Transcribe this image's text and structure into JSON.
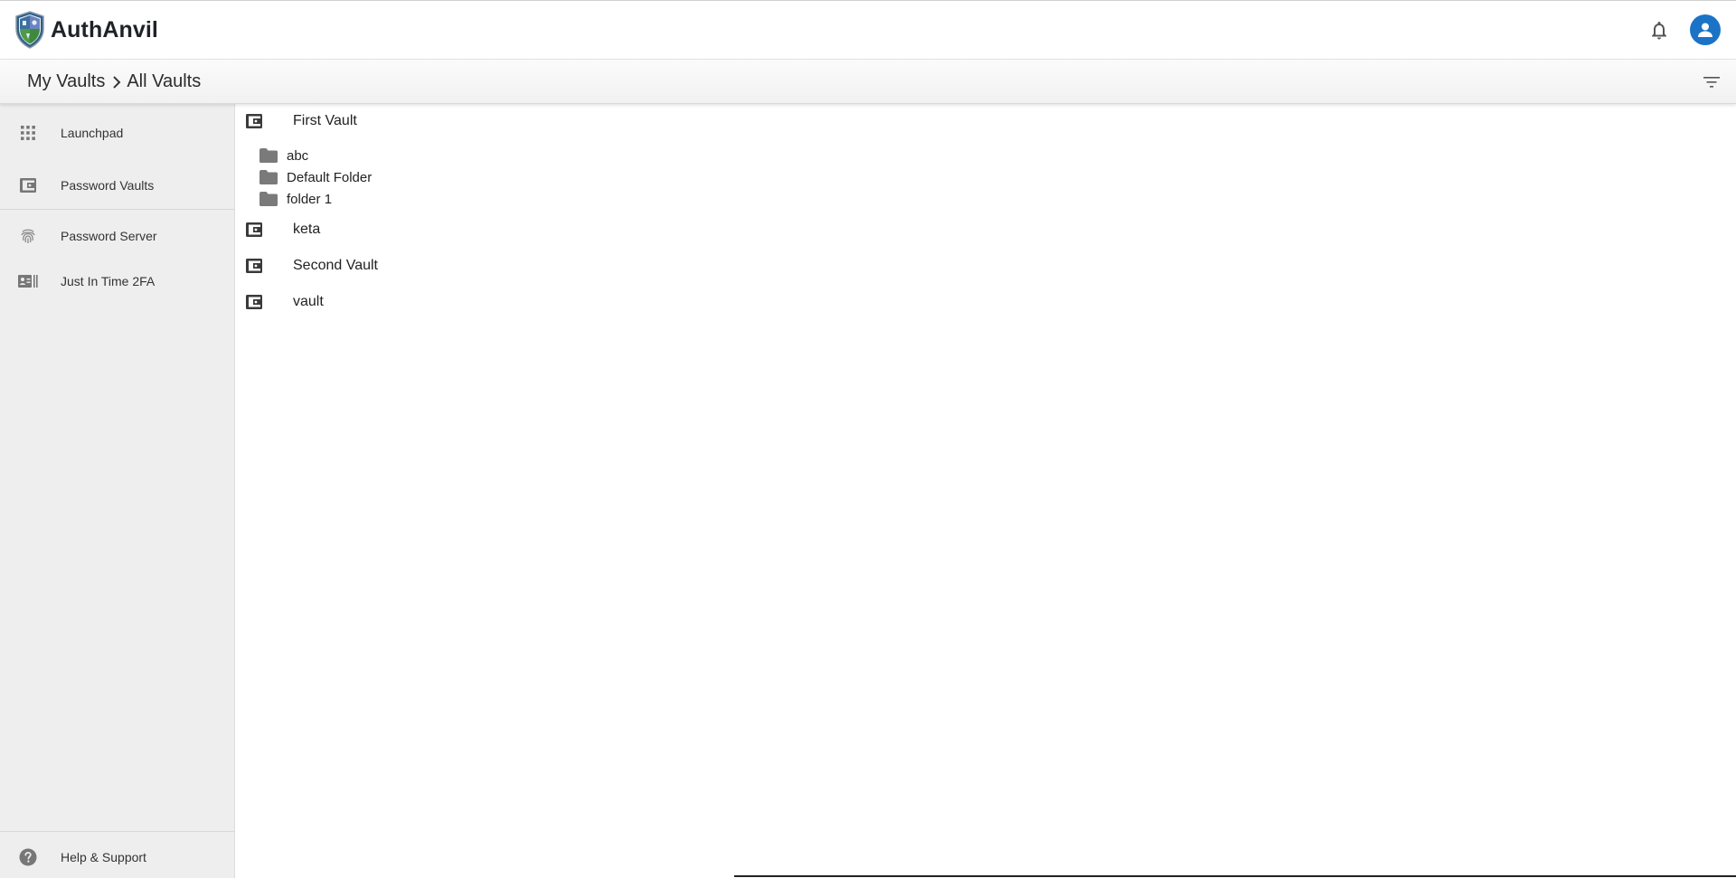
{
  "header": {
    "brand_name": "AuthAnvil",
    "logo_icon": "authanvil-shield-logo",
    "notification_icon": "bell-icon",
    "account_icon": "account-avatar-icon",
    "accent_color": "#1a73c7"
  },
  "breadcrumb": {
    "items": [
      "My Vaults",
      "All Vaults"
    ],
    "separator_icon": "chevron-right-icon",
    "filter_icon": "filter-icon"
  },
  "sidebar": {
    "items": [
      {
        "label": "Launchpad",
        "icon": "apps-grid-icon"
      },
      {
        "label": "Password Vaults",
        "icon": "vault-wallet-icon"
      },
      {
        "label": "Password Server",
        "icon": "fingerprint-icon"
      },
      {
        "label": "Just In Time 2FA",
        "icon": "id-card-icon"
      }
    ],
    "footer": {
      "label": "Help & Support",
      "icon": "help-circle-icon"
    }
  },
  "vaults": [
    {
      "name": "First Vault",
      "folders": [
        "abc",
        "Default Folder",
        "folder 1"
      ]
    },
    {
      "name": "keta",
      "folders": []
    },
    {
      "name": "Second Vault",
      "folders": []
    },
    {
      "name": "vault",
      "folders": []
    }
  ]
}
